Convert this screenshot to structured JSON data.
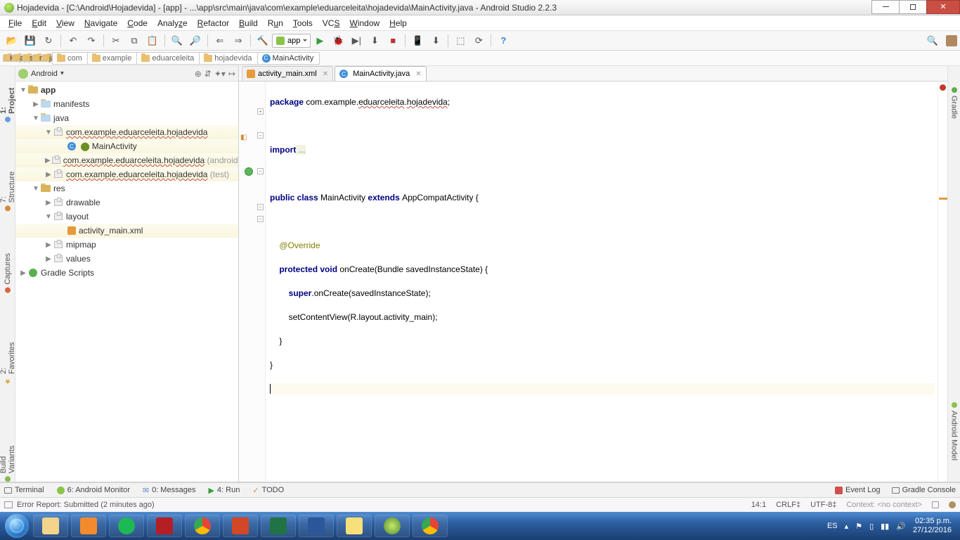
{
  "title": "Hojadevida - [C:\\Android\\Hojadevida] - [app] - ...\\app\\src\\main\\java\\com\\example\\eduarceleita\\hojadevida\\MainActivity.java - Android Studio 2.2.3",
  "menu": [
    "File",
    "Edit",
    "View",
    "Navigate",
    "Code",
    "Analyze",
    "Refactor",
    "Build",
    "Run",
    "Tools",
    "VCS",
    "Window",
    "Help"
  ],
  "runconfig": "app",
  "breadcrumb": [
    "Hojadevida",
    "app",
    "src",
    "main",
    "java",
    "com",
    "example",
    "eduarceleita",
    "hojadevida",
    "MainActivity"
  ],
  "left_tool_tabs": [
    "1: Project",
    "7: Structure",
    "Captures",
    "2: Favorites",
    "Build Variants"
  ],
  "right_tool_tabs": [
    "Gradle",
    "Android Model"
  ],
  "project": {
    "view_label": "Android",
    "root": "app",
    "nodes": {
      "manifests": "manifests",
      "java": "java",
      "pkg1": "com.example.eduarceleita.hojadevida",
      "main_activity": "MainActivity",
      "pkg2_name": "com.example.eduarceleita.hojadevida",
      "pkg2_scope": "(androidTest)",
      "pkg3_name": "com.example.eduarceleita.hojadevida",
      "pkg3_scope": "(test)",
      "res": "res",
      "drawable": "drawable",
      "layout": "layout",
      "activity_main": "activity_main.xml",
      "mipmap": "mipmap",
      "values": "values",
      "gradle": "Gradle Scripts"
    }
  },
  "tabs": [
    {
      "label": "activity_main.xml",
      "type": "xml",
      "active": false
    },
    {
      "label": "MainActivity.java",
      "type": "java",
      "active": true
    }
  ],
  "code": {
    "l1a": "package",
    "l1b": " com.example.",
    "l1c": "eduarceleita",
    "l1d": ".",
    "l1e": "hojadevida",
    "l1f": ";",
    "l3a": "import",
    "l3b": " ...",
    "l5a": "public class ",
    "l5b": "MainActivity ",
    "l5c": "extends ",
    "l5d": "AppCompatActivity {",
    "l7": "    @Override",
    "l8a": "    ",
    "l8b": "protected void ",
    "l8c": "onCreate(Bundle savedInstanceState) {",
    "l9a": "        ",
    "l9b": "super",
    "l9c": ".onCreate(savedInstanceState);",
    "l10": "        setContentView(R.layout.activity_main);",
    "l11": "    }",
    "l12": "}"
  },
  "bottom_tools": {
    "terminal": "Terminal",
    "monitor": "6: Android Monitor",
    "messages": "0: Messages",
    "run": "4: Run",
    "todo": "TODO",
    "eventlog": "Event Log",
    "gradle_console": "Gradle Console"
  },
  "status": {
    "msg": "Error Report: Submitted (2 minutes ago)",
    "pos": "14:1",
    "le": "CRLF‡",
    "enc": "UTF-8‡",
    "context": "Context: <no context>"
  },
  "tray": {
    "lang": "ES",
    "time": "02:35 p.m.",
    "date": "27/12/2016"
  }
}
